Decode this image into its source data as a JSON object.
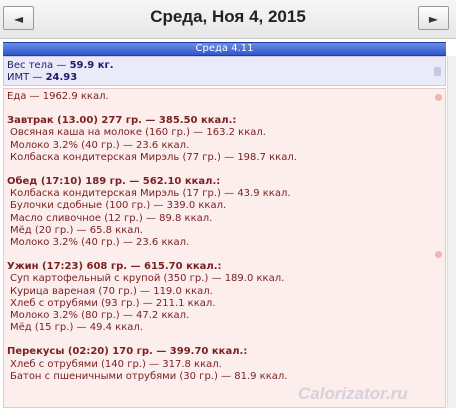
{
  "header": {
    "prev_label": "◄",
    "date_title": "Среда, Ноя 4, 2015",
    "next_label": "►"
  },
  "day_band": "Среда 4.11",
  "body_stats": {
    "weight_label": "Вес тела —",
    "weight_value": "59.9 кг.",
    "bmi_label": "ИМТ —",
    "bmi_value": "24.93"
  },
  "food_total": "Еда — 1962.9 ккал.",
  "meals": [
    {
      "header": "Завтрак (13.00) 277 гр. — 385.50 ккал.:",
      "items": [
        "Овсяная каша на молоке (160 гр.) — 163.2 ккал.",
        "Молоко 3.2% (40 гр.) — 23.6 ккал.",
        "Колбаска кондитерская Мирэль (77 гр.) — 198.7 ккал."
      ]
    },
    {
      "header": "Обед (17:10) 189 гр. — 562.10 ккал.:",
      "items": [
        "Колбаска кондитерская Мирэль (17 гр.) — 43.9 ккал.",
        "Булочки сдобные (100 гр.) — 339.0 ккал.",
        "Масло сливочное (12 гр.) — 89.8 ккал.",
        "Мёд (20 гр.) — 65.8 ккал.",
        "Молоко 3.2% (40 гр.) — 23.6 ккал."
      ]
    },
    {
      "header": "Ужин (17:23) 608 гр. — 615.70 ккал.:",
      "items": [
        "Суп картофельный с крупой (350 гр.) — 189.0 ккал.",
        "Курица вареная (70 гр.) — 119.0 ккал.",
        "Хлеб с отрубями (93 гр.) — 211.1 ккал.",
        "Молоко 3.2% (80 гр.) — 47.2 ккал.",
        "Мёд (15 гр.) — 49.4 ккал."
      ]
    },
    {
      "header": "Перекусы (02:20) 170 гр. — 399.70 ккал.:",
      "items": [
        "Хлеб с отрубями (140 гр.) — 317.8 ккал.",
        "Батон с пшеничными отрубями (30 гр.) — 81.9 ккал."
      ]
    }
  ],
  "watermark": "Calorizator.ru"
}
